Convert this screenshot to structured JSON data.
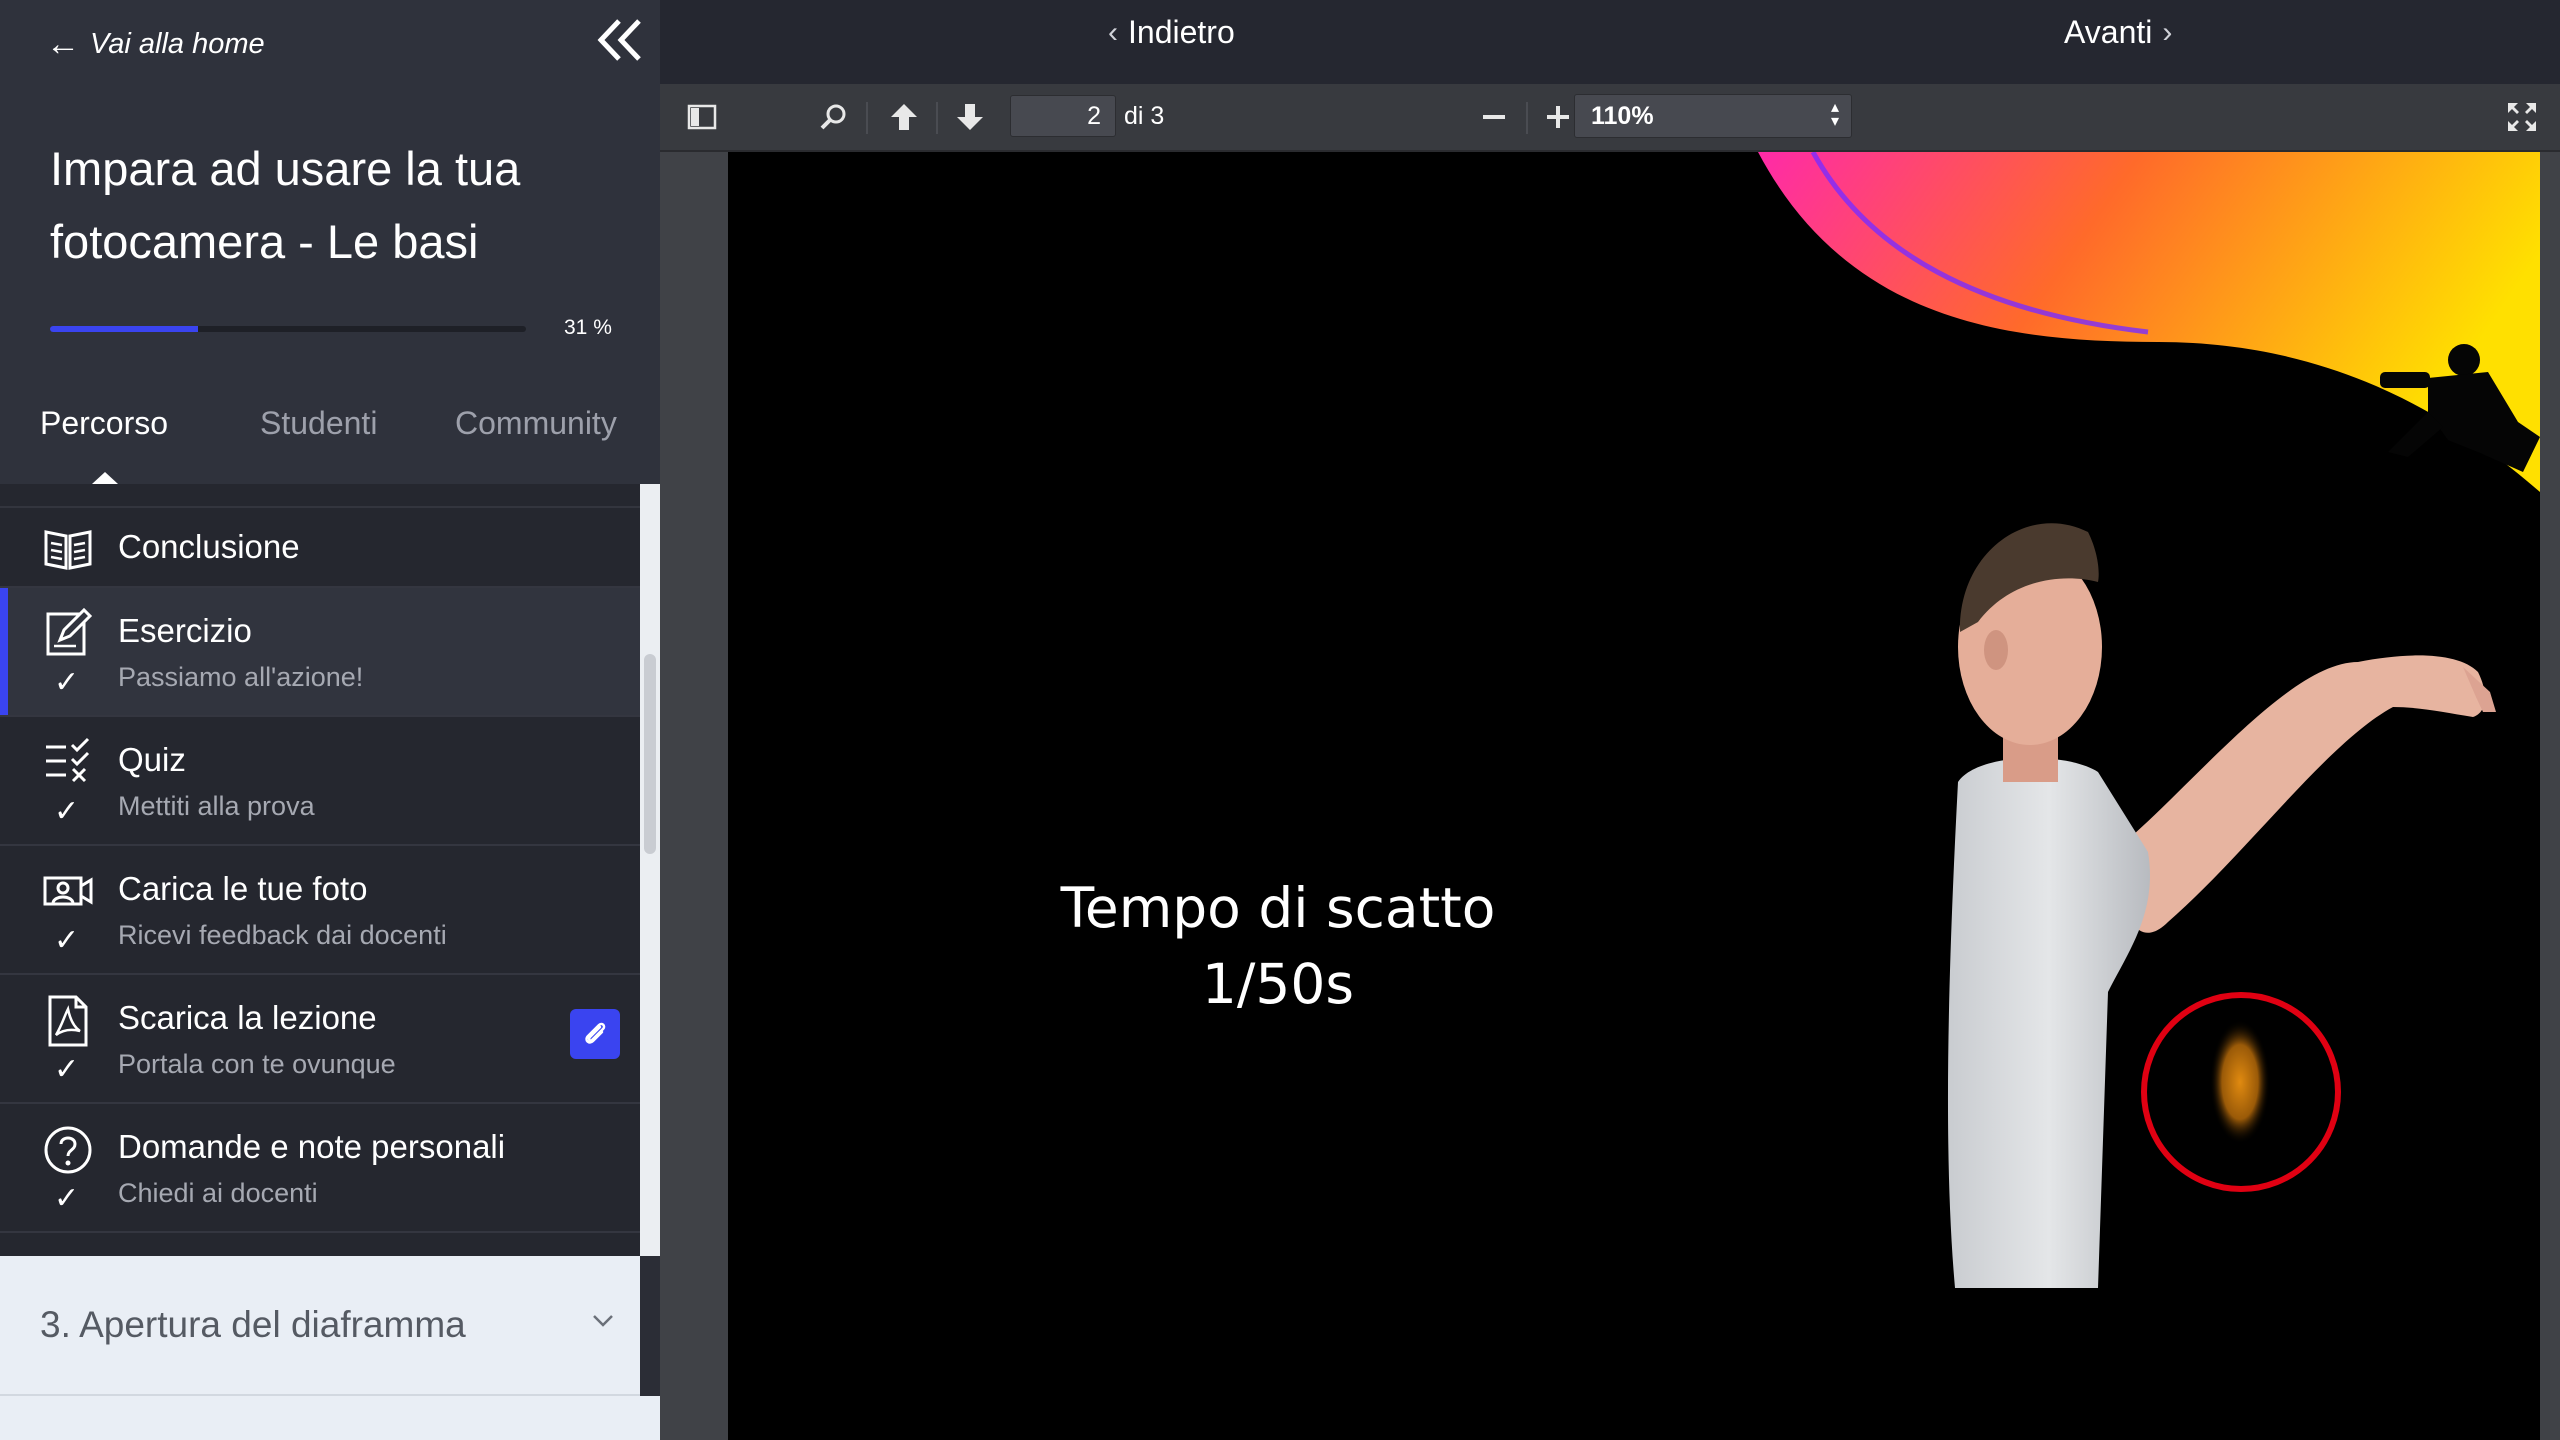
{
  "sidebar": {
    "home_link": "Vai alla home",
    "course_title": "Impara ad usare la tua fotocamera - Le basi",
    "progress_percent": 31,
    "progress_label": "31 %",
    "tabs": [
      {
        "label": "Percorso",
        "active": true
      },
      {
        "label": "Studenti",
        "active": false
      },
      {
        "label": "Community",
        "active": false
      }
    ],
    "items": [
      {
        "title": "Conclusione",
        "subtitle": "",
        "icon": "book-icon",
        "checked": false,
        "active": false
      },
      {
        "title": "Esercizio",
        "subtitle": "Passiamo all'azione!",
        "icon": "edit-note-icon",
        "checked": true,
        "active": true
      },
      {
        "title": "Quiz",
        "subtitle": "Mettiti alla prova",
        "icon": "checklist-icon",
        "checked": true,
        "active": false
      },
      {
        "title": "Carica le tue foto",
        "subtitle": "Ricevi feedback dai docenti",
        "icon": "upload-photo-icon",
        "checked": true,
        "active": false
      },
      {
        "title": "Scarica la lezione",
        "subtitle": "Portala con te ovunque",
        "icon": "pdf-icon",
        "checked": true,
        "active": false,
        "attachment": true
      },
      {
        "title": "Domande e note personali",
        "subtitle": "Chiedi ai docenti",
        "icon": "question-icon",
        "checked": true,
        "active": false
      }
    ],
    "section": {
      "title": "3. Apertura del diaframma"
    }
  },
  "topbar": {
    "back_label": "Indietro",
    "next_label": "Avanti"
  },
  "pdf_toolbar": {
    "page_number": "2",
    "page_total": "di 3",
    "zoom": "110%"
  },
  "slide": {
    "line1": "Tempo di scatto",
    "line2": "1/50s"
  },
  "colors": {
    "accent": "#3a44f0",
    "sidebar_bg": "#2b2d36",
    "highlight_circle": "#e00012"
  }
}
